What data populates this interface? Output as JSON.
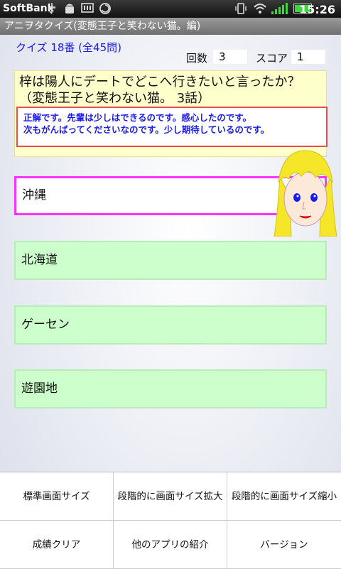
{
  "status_bar": {
    "carrier": "SoftBank",
    "time": "15:26",
    "icons": [
      "usb-icon",
      "android-debug-icon",
      "sd-card-icon",
      "sync-icon",
      "vibrate-icon",
      "wifi-icon",
      "signal-icon",
      "battery-icon"
    ]
  },
  "app": {
    "title": "アニヲタクイズ(変態王子と笑わない猫。編)"
  },
  "quiz": {
    "number_label": "クイズ 18番 (全45問)",
    "count_label": "回数",
    "count_value": "3",
    "score_label": "スコア",
    "score_value": "1"
  },
  "question": {
    "text": "梓は陽人にデートでどこへ行きたいと言ったか？（変態王子と笑わない猫。 3話）",
    "feedback_line1": "正解です。先輩は少しはできるのです。感心したのです。",
    "feedback_line2": "次もがんばってくださいなのです。少し期待しているのです。"
  },
  "answers": [
    {
      "label": "沖縄",
      "selected": true
    },
    {
      "label": "北海道",
      "selected": false
    },
    {
      "label": "ゲーセン",
      "selected": false
    },
    {
      "label": "遊園地",
      "selected": false
    }
  ],
  "menu": {
    "items": [
      {
        "label": "標準画面サイズ"
      },
      {
        "label": "段階的に画面サイズ拡大"
      },
      {
        "label": "段階的に画面サイズ縮小"
      },
      {
        "label": "成績クリア"
      },
      {
        "label": "他のアプリの紹介"
      },
      {
        "label": "バージョン"
      }
    ]
  },
  "colors": {
    "accent_blue": "#1a1aee",
    "answer_bg": "#ccffcc",
    "selected_border": "#ff33ff",
    "feedback_border": "#e85050",
    "question_bg": "#ffffcc"
  }
}
